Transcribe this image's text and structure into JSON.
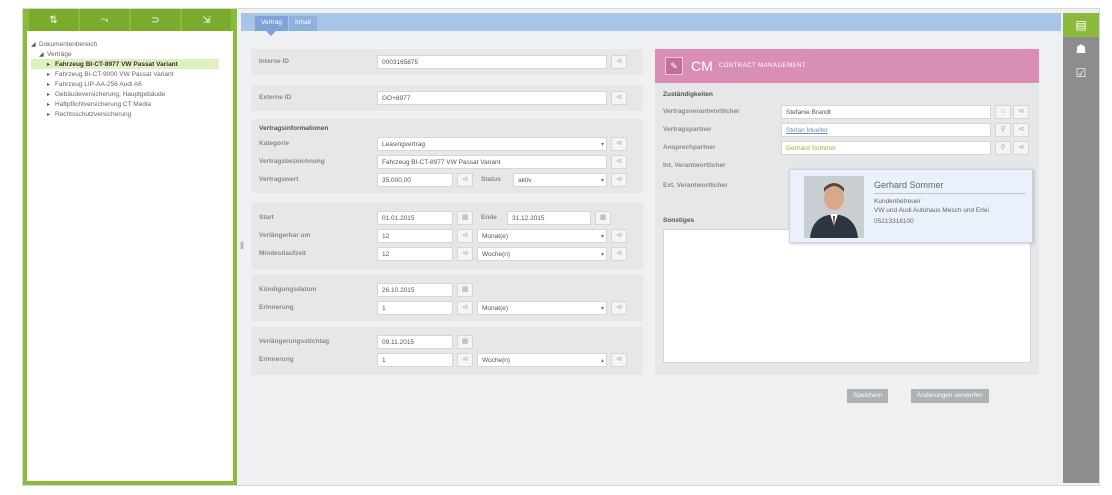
{
  "tree": {
    "root": "Dokumentenbereich",
    "folder": "Verträge",
    "items": [
      "Fahrzeug BI-CT-8977 VW Passat Variant",
      "Fahrzeug BI-CT-9000 VW Passat Variant",
      "Fahrzeug LIP-AA-256 Audi A6",
      "Gebäudeversicherung, Hauptgebäude",
      "Haftpflichtversicherung CT Media",
      "Rechtsschutzversicherung"
    ]
  },
  "tabs": [
    "Vertrag",
    "Inhalt"
  ],
  "form": {
    "interne_id_label": "Interne ID",
    "interne_id": "0003165875",
    "externe_id_label": "Externe ID",
    "externe_id": "GO+8977",
    "section_title": "Vertragsinformationen",
    "kategorie_label": "Kategorie",
    "kategorie": "Leasingvertrag",
    "bezeichnung_label": "Vertragsbezeichnung",
    "bezeichnung": "Fahrzeug BI-CT-8977 VW Passat Variant",
    "wert_label": "Vertragswert",
    "wert": "35.000,00",
    "status_label": "Status",
    "status": "aktiv",
    "start_label": "Start",
    "start": "01.01.2015",
    "ende_label": "Ende",
    "ende": "31.12.2015",
    "verl_um_label": "Verlängerbar um",
    "verl_um": "12",
    "verl_um_unit": "Monat(e)",
    "mindest_label": "Mindestlaufzeit",
    "mindest": "12",
    "mindest_unit": "Woche(n)",
    "kuend_label": "Kündigungsdatum",
    "kuend": "26.10.2015",
    "erinn1_label": "Erinnerung",
    "erinn1": "1",
    "erinn1_unit": "Monat(e)",
    "stichtag_label": "Verlängerungsstichtag",
    "stichtag": "09.11.2015",
    "erinn2_label": "Erinnerung",
    "erinn2": "1",
    "erinn2_unit": "Woche(n)"
  },
  "cm": {
    "logo_text": "CM",
    "subtitle": "CONTRACT MANAGEMENT",
    "zust_title": "Zuständigkeiten",
    "verantw_label": "Vertragsverantwortlicher",
    "verantw": "Stefanie Brandt",
    "partner_label": "Vertragspartner",
    "partner": "Stefan Mueller",
    "ansprech_label": "Ansprechpartner",
    "ansprech": "Gerhard Sommer",
    "int_label": "Int. Verantwortlicher",
    "ext_label": "Ext. Verantwortlicher",
    "sonstiges_label": "Sonstiges"
  },
  "popup": {
    "name": "Gerhard Sommer",
    "role": "Kundenbetreuer",
    "company": "VW und Audi Autohaus Mesch und Erlei",
    "phone": "05213318100"
  },
  "buttons": {
    "save": "Speichern",
    "discard": "Änderungen verwerfen"
  },
  "icons": {
    "toolbar": [
      "tree-expand-icon",
      "tree-add-icon",
      "tree-link-icon",
      "tree-collapse-icon"
    ],
    "sidebar": [
      "document-icon",
      "user-icon",
      "checklist-icon"
    ]
  },
  "colors": {
    "green": "#8cbb3c",
    "blue_header": "#a8c4e6",
    "cm_pink": "#d98fb5"
  }
}
